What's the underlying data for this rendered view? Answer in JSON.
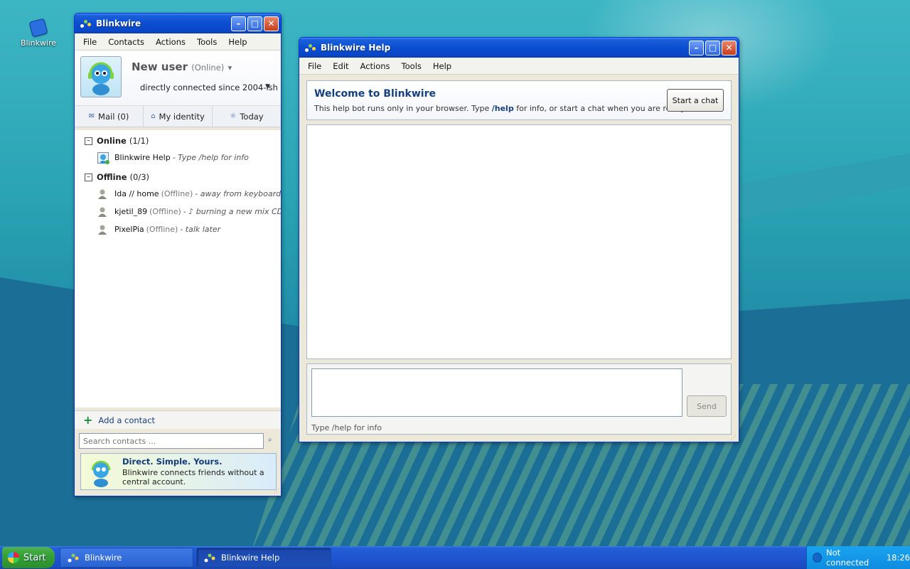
{
  "desktop": {
    "icon_label": "Blinkwire"
  },
  "main_window": {
    "title": "Blinkwire",
    "menu": [
      "File",
      "Contacts",
      "Actions",
      "Tools",
      "Help"
    ],
    "profile": {
      "name": "New user",
      "status": "(Online)",
      "message": "directly connected since 2004-ish"
    },
    "quick_tabs": [
      {
        "icon": "mail-icon",
        "label": "Mail (0)"
      },
      {
        "icon": "home-icon",
        "label": "My identity"
      },
      {
        "icon": "sun-icon",
        "label": "Today"
      }
    ],
    "groups": [
      {
        "name": "Online",
        "count": "(1/1)",
        "contacts": [
          {
            "name": "Blinkwire Help",
            "status": "",
            "message": "- Type /help for info"
          }
        ]
      },
      {
        "name": "Offline",
        "count": "(0/3)",
        "contacts": [
          {
            "name": "Ida // home",
            "status": "(Offline)",
            "message": "- away from keyboard"
          },
          {
            "name": "kjetil_89",
            "status": "(Offline)",
            "message": "- ♪ burning a new mix CD"
          },
          {
            "name": "PixelPia",
            "status": "(Offline)",
            "message": "- talk later"
          }
        ]
      }
    ],
    "add_contact_label": "Add a contact",
    "search_placeholder": "Search contacts ...",
    "promo": {
      "title": "Direct. Simple. Yours.",
      "text": "Blinkwire connects friends without a central account."
    }
  },
  "help_window": {
    "title": "Blinkwire Help",
    "menu": [
      "File",
      "Edit",
      "Actions",
      "Tools",
      "Help"
    ],
    "welcome_title": "Welcome to Blinkwire",
    "welcome_text_before": "This help bot runs only in your browser. Type ",
    "welcome_text_cmd": "/help",
    "welcome_text_after": " for info, or start a chat when you are ready.",
    "start_chat_label": "Start a chat",
    "send_label": "Send",
    "compose_hint": "Type /help for info"
  },
  "taskbar": {
    "start_label": "Start",
    "items": [
      "Blinkwire",
      "Blinkwire Help"
    ],
    "tray_status": "Not connected",
    "clock": "18:26"
  },
  "colors": {
    "titlebar": "#0a4fd0",
    "accent_text": "#17407e",
    "taskbar": "#1f55cf",
    "start_green": "#36a136"
  }
}
